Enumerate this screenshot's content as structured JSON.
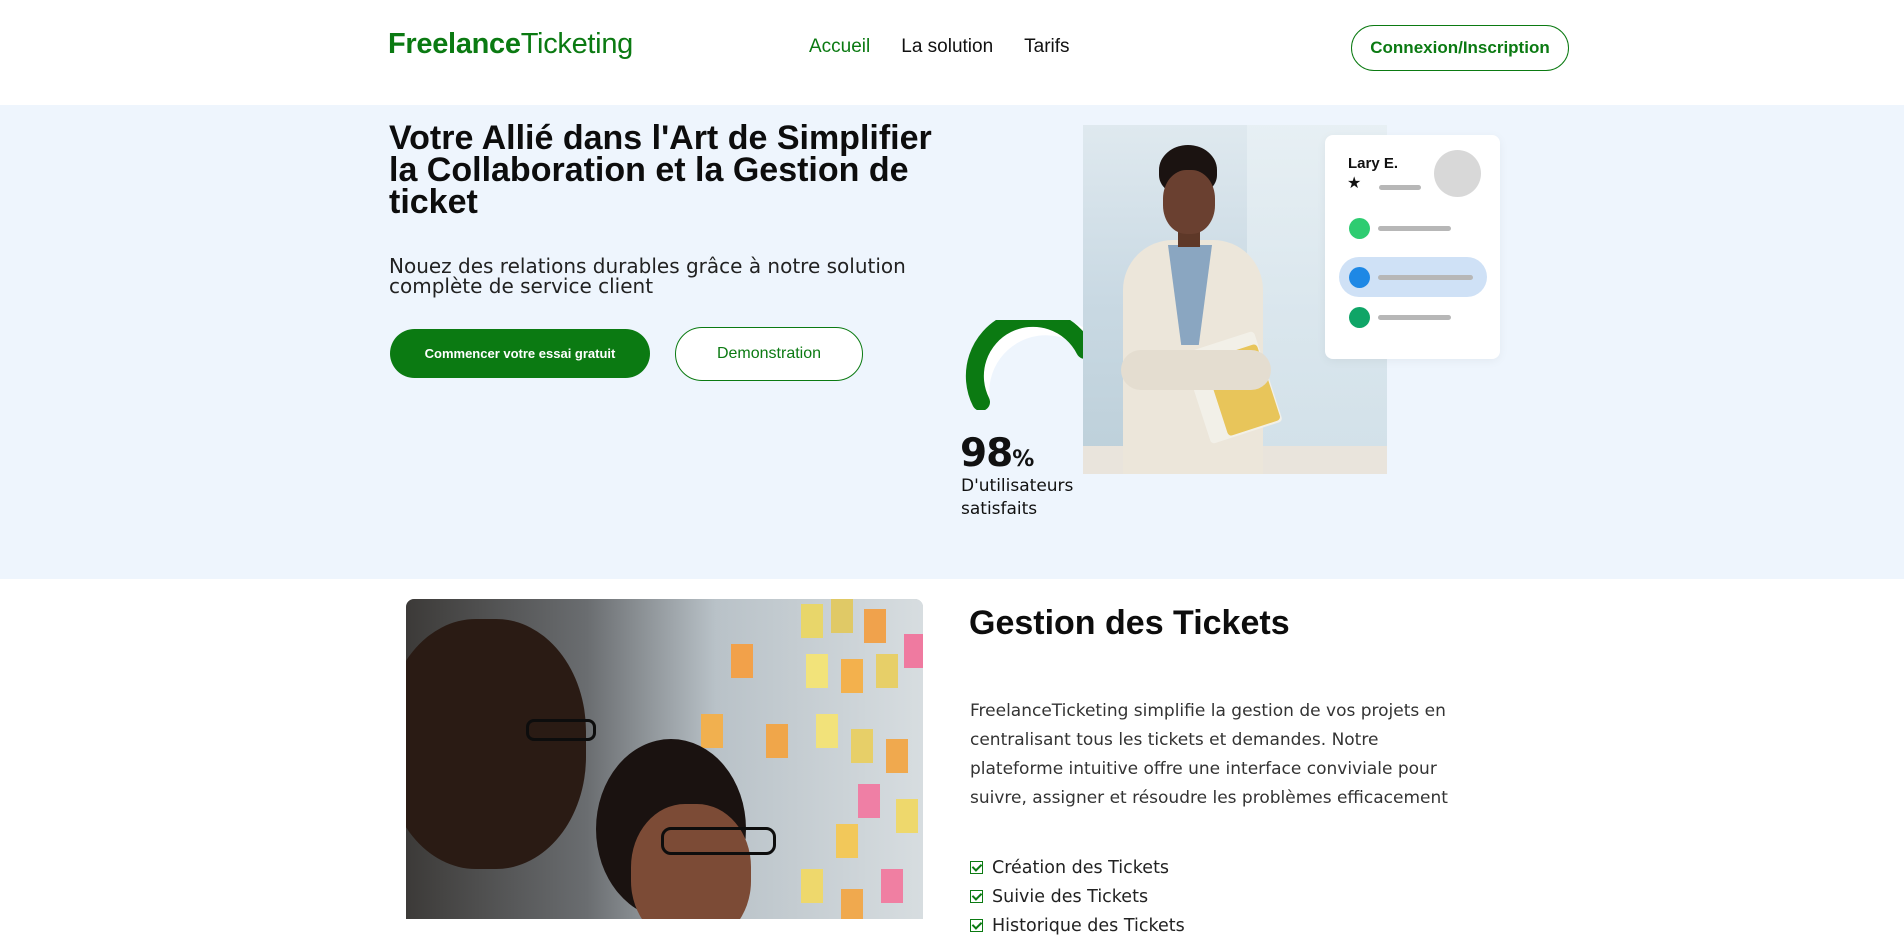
{
  "header": {
    "logo_bold": "Freelance",
    "logo_light": "Ticketing",
    "nav": [
      {
        "label": "Accueil",
        "active": true
      },
      {
        "label": "La solution",
        "active": false
      },
      {
        "label": "Tarifs",
        "active": false
      }
    ],
    "login_label": "Connexion/Inscription"
  },
  "hero": {
    "title": "Votre Allié dans l'Art de Simplifier la Collaboration et la Gestion de ticket",
    "subtitle": "Nouez des relations durables grâce à notre solution complète de service client",
    "primary_button": "Commencer votre essai gratuit",
    "secondary_button": "Demonstration",
    "stat_value": "98",
    "stat_unit": "%",
    "stat_label": "D'utilisateurs satisfaits",
    "gauge_fraction": 0.98,
    "profile_name": "Lary E.",
    "star_icon": "star-icon"
  },
  "section": {
    "title": "Gestion des Tickets",
    "text": "FreelanceTicketing simplifie la gestion de vos projets en centralisant tous les tickets et demandes. Notre plateforme intuitive offre une interface conviviale pour suivre, assigner et résoudre les problèmes efficacement",
    "features": [
      "Création des Tickets",
      "Suivie des Tickets",
      "Historique des Tickets"
    ]
  },
  "colors": {
    "brand": "#0b7a12",
    "hero_bg": "#eef5fd",
    "dot_green_light": "#2ecc71",
    "dot_blue": "#1e88e5",
    "dot_green": "#0fa567",
    "highlight": "#cfe1f6"
  }
}
